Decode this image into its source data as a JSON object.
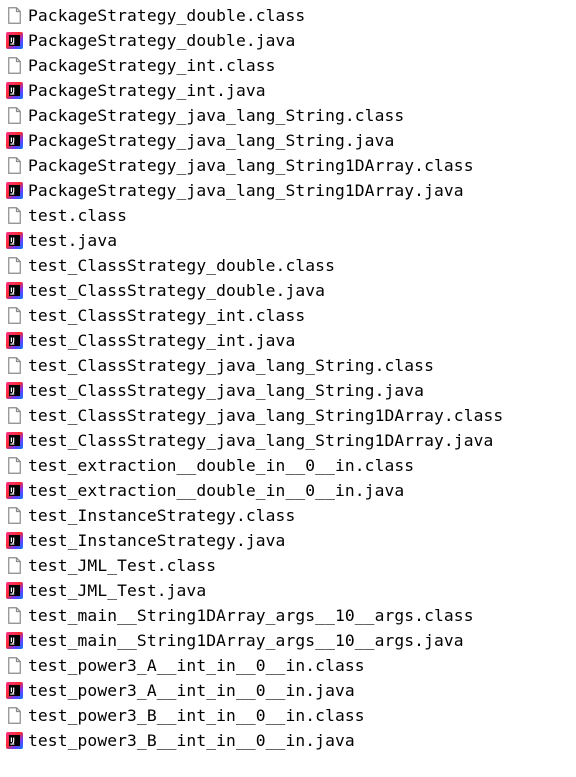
{
  "files": [
    {
      "name": "PackageStrategy_double.class",
      "icon": "class-file-icon"
    },
    {
      "name": "PackageStrategy_double.java",
      "icon": "intellij-java-file-icon"
    },
    {
      "name": "PackageStrategy_int.class",
      "icon": "class-file-icon"
    },
    {
      "name": "PackageStrategy_int.java",
      "icon": "intellij-java-file-icon"
    },
    {
      "name": "PackageStrategy_java_lang_String.class",
      "icon": "class-file-icon"
    },
    {
      "name": "PackageStrategy_java_lang_String.java",
      "icon": "intellij-java-file-icon"
    },
    {
      "name": "PackageStrategy_java_lang_String1DArray.class",
      "icon": "class-file-icon"
    },
    {
      "name": "PackageStrategy_java_lang_String1DArray.java",
      "icon": "intellij-java-file-icon"
    },
    {
      "name": "test.class",
      "icon": "class-file-icon"
    },
    {
      "name": "test.java",
      "icon": "intellij-java-file-icon"
    },
    {
      "name": "test_ClassStrategy_double.class",
      "icon": "class-file-icon"
    },
    {
      "name": "test_ClassStrategy_double.java",
      "icon": "intellij-java-file-icon"
    },
    {
      "name": "test_ClassStrategy_int.class",
      "icon": "class-file-icon"
    },
    {
      "name": "test_ClassStrategy_int.java",
      "icon": "intellij-java-file-icon"
    },
    {
      "name": "test_ClassStrategy_java_lang_String.class",
      "icon": "class-file-icon"
    },
    {
      "name": "test_ClassStrategy_java_lang_String.java",
      "icon": "intellij-java-file-icon"
    },
    {
      "name": "test_ClassStrategy_java_lang_String1DArray.class",
      "icon": "class-file-icon"
    },
    {
      "name": "test_ClassStrategy_java_lang_String1DArray.java",
      "icon": "intellij-java-file-icon"
    },
    {
      "name": "test_extraction__double_in__0__in.class",
      "icon": "class-file-icon"
    },
    {
      "name": "test_extraction__double_in__0__in.java",
      "icon": "intellij-java-file-icon"
    },
    {
      "name": "test_InstanceStrategy.class",
      "icon": "class-file-icon"
    },
    {
      "name": "test_InstanceStrategy.java",
      "icon": "intellij-java-file-icon"
    },
    {
      "name": "test_JML_Test.class",
      "icon": "class-file-icon"
    },
    {
      "name": "test_JML_Test.java",
      "icon": "intellij-java-file-icon"
    },
    {
      "name": "test_main__String1DArray_args__10__args.class",
      "icon": "class-file-icon"
    },
    {
      "name": "test_main__String1DArray_args__10__args.java",
      "icon": "intellij-java-file-icon"
    },
    {
      "name": "test_power3_A__int_in__0__in.class",
      "icon": "class-file-icon"
    },
    {
      "name": "test_power3_A__int_in__0__in.java",
      "icon": "intellij-java-file-icon"
    },
    {
      "name": "test_power3_B__int_in__0__in.class",
      "icon": "class-file-icon"
    },
    {
      "name": "test_power3_B__int_in__0__in.java",
      "icon": "intellij-java-file-icon"
    }
  ],
  "colors": {
    "text": "#000000",
    "background": "#ffffff",
    "blank_icon_stroke": "#8a8a8a",
    "ij_gradient_red": "#ff2b4f",
    "ij_gradient_blue": "#2a62ff",
    "ij_inner": "#000000"
  }
}
